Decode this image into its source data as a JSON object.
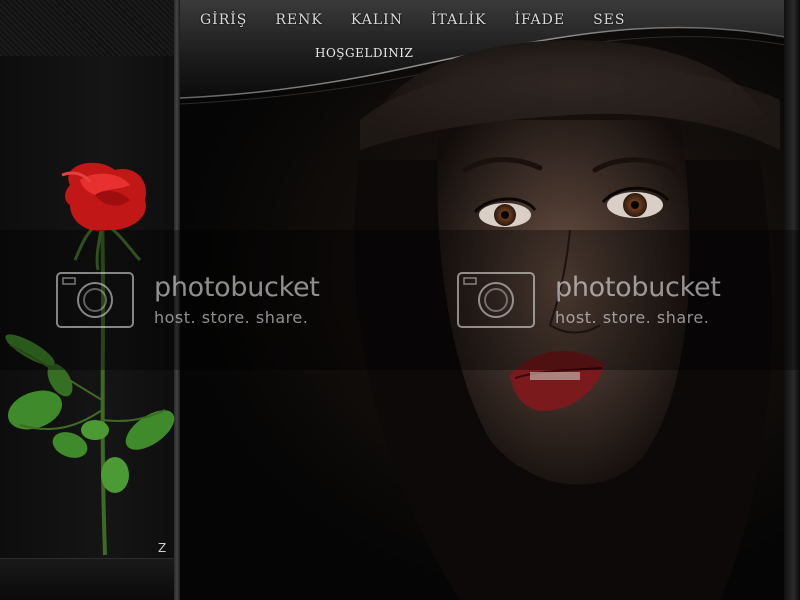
{
  "menu": {
    "items": [
      {
        "label": "GİRİŞ"
      },
      {
        "label": "RENK"
      },
      {
        "label": "KALIN"
      },
      {
        "label": "İTALİK"
      },
      {
        "label": "İFADE"
      },
      {
        "label": "SES"
      }
    ]
  },
  "welcome": "HOŞGELDINIZ",
  "watermarks": [
    {
      "title": "photobucket",
      "subtitle": "host. store. share."
    },
    {
      "title": "photobucket",
      "subtitle": "host. store. share."
    }
  ],
  "signature_mark": "Z",
  "colors": {
    "background": "#050505",
    "menu_text": "#d7d7d7",
    "rose_red": "#d61f1f",
    "leaf_green": "#3f8a2a",
    "watermark": "#ffffff"
  },
  "icons": [
    "camera-icon"
  ]
}
